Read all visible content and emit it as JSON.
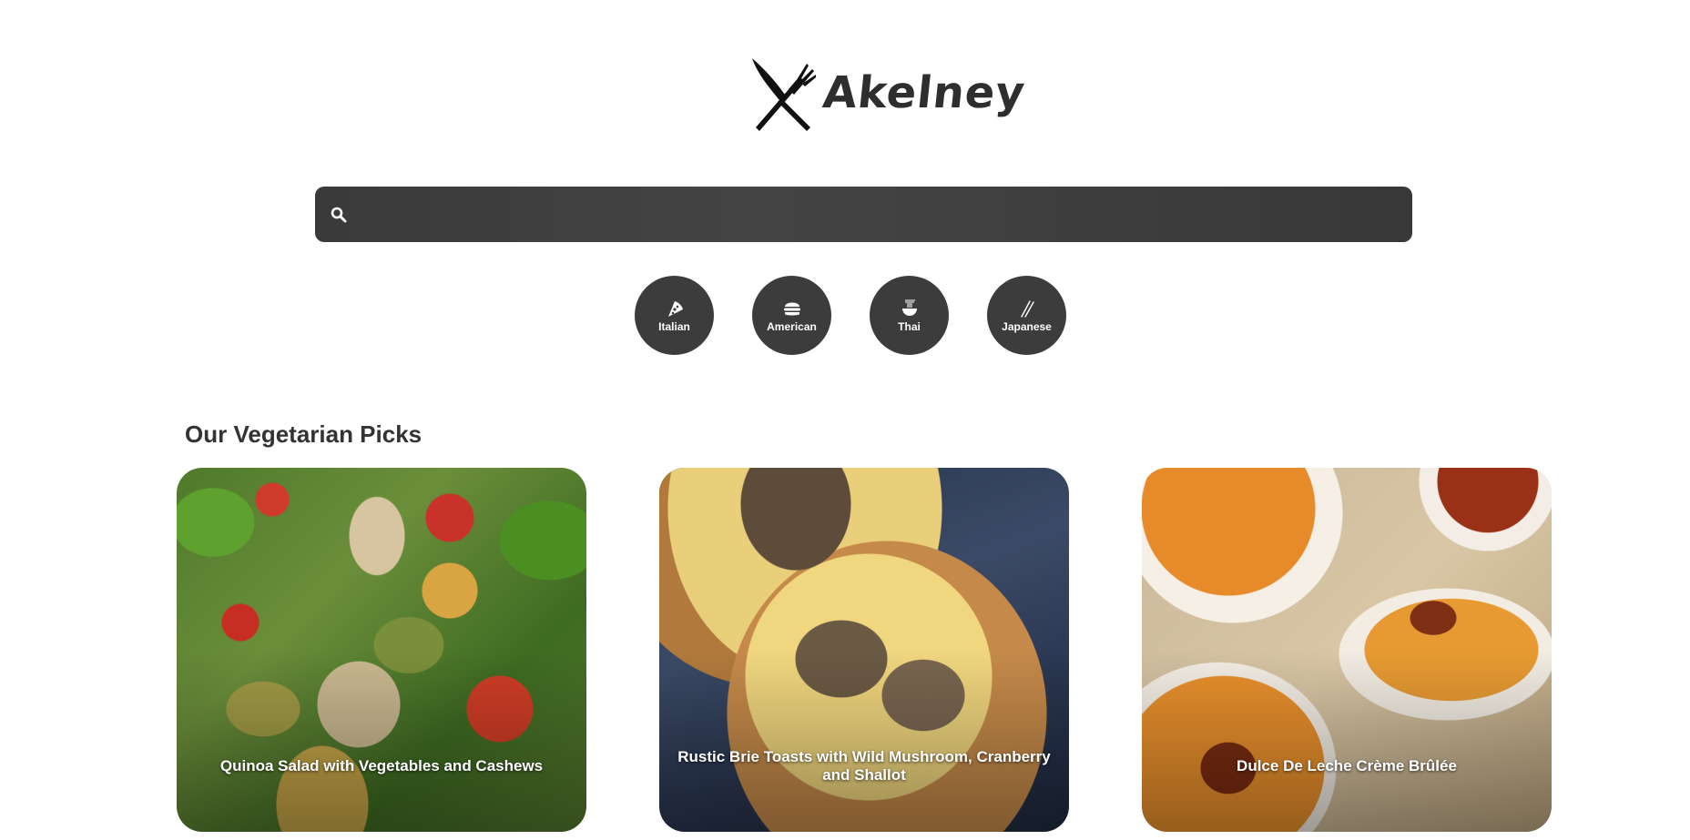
{
  "brand": {
    "name": "Akelney",
    "logo_icon": "knife-fork-icon"
  },
  "search": {
    "icon": "search-icon",
    "placeholder": "",
    "value": ""
  },
  "cuisines": [
    {
      "label": "Italian",
      "icon": "pizza-icon"
    },
    {
      "label": "American",
      "icon": "burger-icon"
    },
    {
      "label": "Thai",
      "icon": "noodle-bowl-icon"
    },
    {
      "label": "Japanese",
      "icon": "chopsticks-icon"
    }
  ],
  "section": {
    "title": "Our Vegetarian Picks"
  },
  "recipes": [
    {
      "title": "Quinoa Salad with Vegetables and Cashews"
    },
    {
      "title": "Rustic Brie Toasts with Wild Mushroom, Cranberry and Shallot"
    },
    {
      "title": "Dulce De Leche Crème Brûlée"
    }
  ],
  "colors": {
    "dark_ui": "#3c3c3c",
    "heading_text": "#333333",
    "background": "#ffffff"
  }
}
